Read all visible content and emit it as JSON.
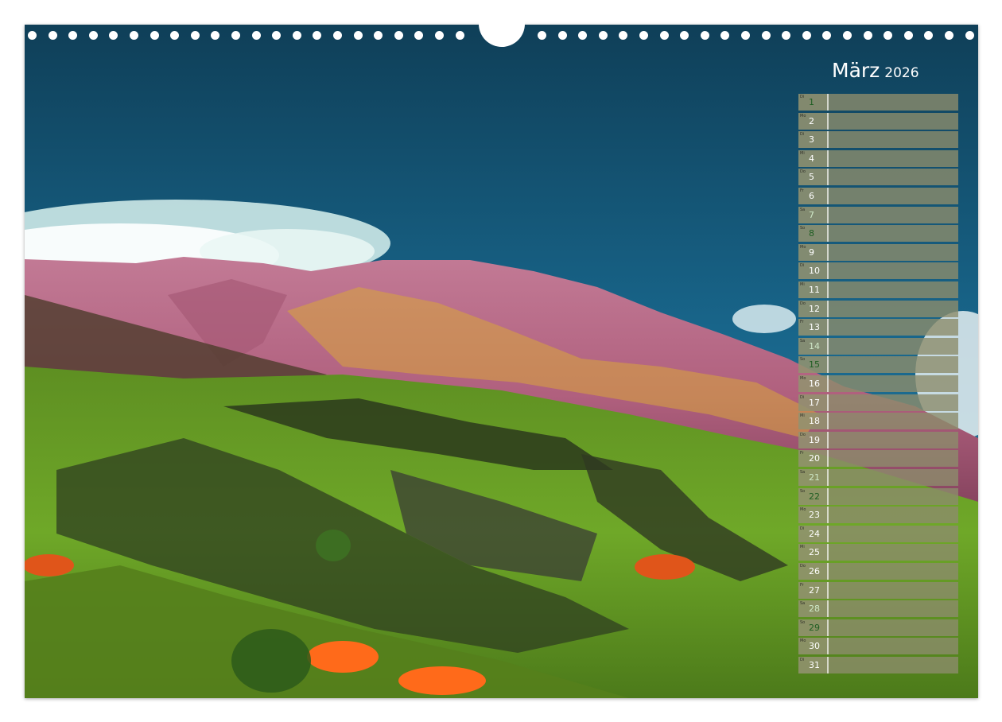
{
  "calendar": {
    "month": "März",
    "year": "2026",
    "days": [
      {
        "wd": "Di",
        "num": "1",
        "type": "saturday"
      },
      {
        "wd": "Mo",
        "num": "2",
        "type": "weekday"
      },
      {
        "wd": "Di",
        "num": "3",
        "type": "weekday"
      },
      {
        "wd": "Mi",
        "num": "4",
        "type": "weekday"
      },
      {
        "wd": "Do",
        "num": "5",
        "type": "weekday"
      },
      {
        "wd": "Fr",
        "num": "6",
        "type": "weekday"
      },
      {
        "wd": "Sa",
        "num": "7",
        "type": "sunday"
      },
      {
        "wd": "So",
        "num": "8",
        "type": "saturday"
      },
      {
        "wd": "Mo",
        "num": "9",
        "type": "weekday"
      },
      {
        "wd": "Di",
        "num": "10",
        "type": "weekday"
      },
      {
        "wd": "Mi",
        "num": "11",
        "type": "weekday"
      },
      {
        "wd": "Do",
        "num": "12",
        "type": "weekday"
      },
      {
        "wd": "Fr",
        "num": "13",
        "type": "weekday"
      },
      {
        "wd": "Sa",
        "num": "14",
        "type": "sunday"
      },
      {
        "wd": "So",
        "num": "15",
        "type": "saturday"
      },
      {
        "wd": "Mo",
        "num": "16",
        "type": "weekday"
      },
      {
        "wd": "Di",
        "num": "17",
        "type": "weekday"
      },
      {
        "wd": "Mi",
        "num": "18",
        "type": "weekday"
      },
      {
        "wd": "Do",
        "num": "19",
        "type": "weekday"
      },
      {
        "wd": "Fr",
        "num": "20",
        "type": "weekday"
      },
      {
        "wd": "Sa",
        "num": "21",
        "type": "sunday"
      },
      {
        "wd": "So",
        "num": "22",
        "type": "saturday"
      },
      {
        "wd": "Mo",
        "num": "23",
        "type": "weekday"
      },
      {
        "wd": "Di",
        "num": "24",
        "type": "weekday"
      },
      {
        "wd": "Mi",
        "num": "25",
        "type": "weekday"
      },
      {
        "wd": "Do",
        "num": "26",
        "type": "weekday"
      },
      {
        "wd": "Fr",
        "num": "27",
        "type": "weekday"
      },
      {
        "wd": "Sa",
        "num": "28",
        "type": "sunday"
      },
      {
        "wd": "So",
        "num": "29",
        "type": "saturday"
      },
      {
        "wd": "Mo",
        "num": "30",
        "type": "weekday"
      },
      {
        "wd": "Di",
        "num": "31",
        "type": "weekday"
      }
    ]
  },
  "colors": {
    "sky_dark": "#10455e",
    "sky_mid": "#1a6a8c",
    "mountain_pink": "#b86a8a",
    "meadow_green": "#7ab52a",
    "gorse_orange": "#ff6a1a",
    "calendar_cell": "#929270"
  }
}
